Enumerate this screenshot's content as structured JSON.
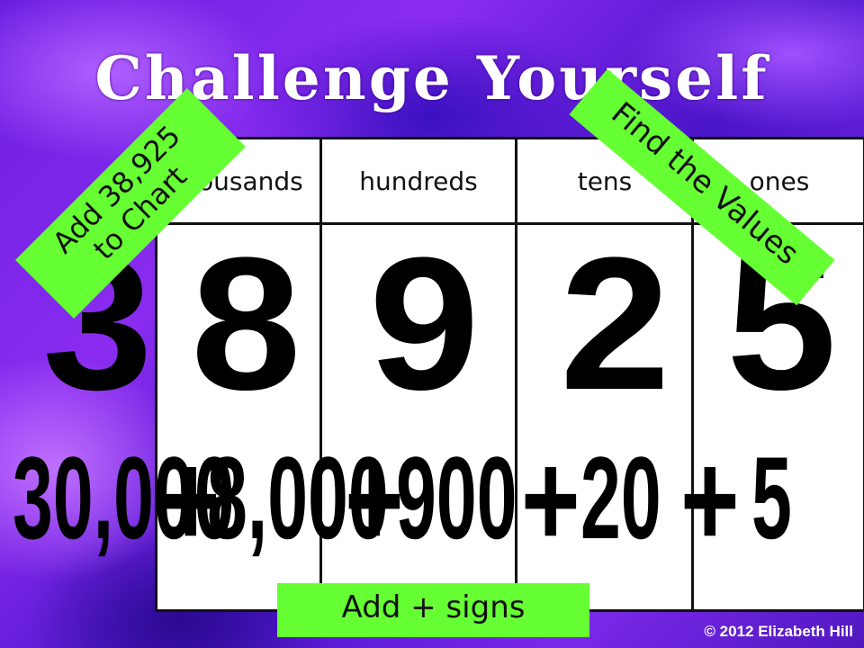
{
  "title": "Challenge Yourself",
  "table": {
    "headers": [
      "thousands",
      "hundreds",
      "tens",
      "ones"
    ]
  },
  "digits": [
    "3",
    "8",
    "9",
    "2",
    "5"
  ],
  "expanded": [
    "30,000",
    "8,000",
    "900",
    "20",
    "5"
  ],
  "plus": "+",
  "banners": {
    "left_line1": "Add 38,925",
    "left_line2": "to Chart",
    "right": "Find the Values",
    "bottom": "Add + signs"
  },
  "copyright": "© 2012 Elizabeth Hill",
  "colors": {
    "banner": "#66ff33",
    "background": "#6a1ee0"
  }
}
